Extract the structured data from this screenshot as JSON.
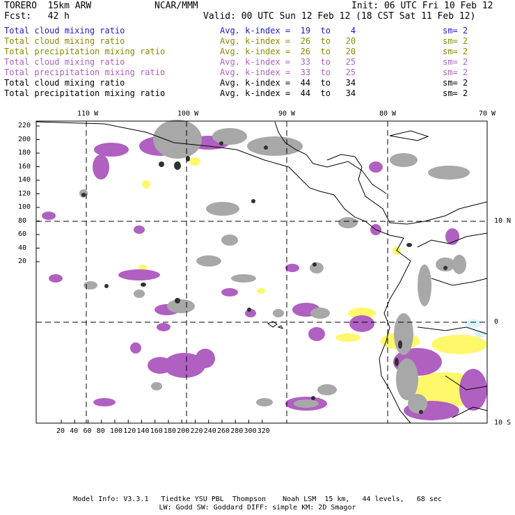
{
  "header": {
    "model": "TORERO  15km ARW",
    "org": "NCAR/MMM",
    "init": "Init: 06 UTC Fri 10 Feb 12",
    "fcst": "Fcst:   42 h",
    "valid": "Valid: 00 UTC Sun 12 Feb 12 (18 CST Sat 11 Feb 12)"
  },
  "legend": [
    {
      "field": "Total cloud mixing ratio",
      "kindex": "Avg. k-index =  19  to    4",
      "sm": "sm= 2",
      "color": "#1a1acc"
    },
    {
      "field": "Total cloud mixing ratio",
      "kindex": "Avg. k-index =  26  to   20",
      "sm": "sm= 2",
      "color": "#8a8a00"
    },
    {
      "field": "Total precipitation mixing ratio",
      "kindex": "Avg. k-index =  26  to   20",
      "sm": "sm= 2",
      "color": "#8a8a00"
    },
    {
      "field": "Total cloud mixing ratio",
      "kindex": "Avg. k-index =  33  to   25",
      "sm": "sm= 2",
      "color": "#b060c0"
    },
    {
      "field": "Total precipitation mixing ratio",
      "kindex": "Avg. k-index =  33  to   25",
      "sm": "sm= 2",
      "color": "#b060c0"
    },
    {
      "field": "Total cloud mixing ratio",
      "kindex": "Avg. k-index =  44  to   34",
      "sm": "sm= 2",
      "color": "#000000"
    },
    {
      "field": "Total precipitation mixing ratio",
      "kindex": "Avg. k-index =  44  to   34",
      "sm": "sm= 2",
      "color": "#000000"
    }
  ],
  "map": {
    "lon_labels": [
      "110 W",
      "100 W",
      "90 W",
      "80 W",
      "70 W"
    ],
    "lat_labels": [
      "10 N",
      "0",
      "10 S"
    ],
    "y_grid_labels": [
      "220",
      "200",
      "180",
      "160",
      "140",
      "120",
      "100",
      "80",
      "60",
      "40",
      "20"
    ],
    "x_grid_labels": [
      "20",
      "40",
      "60",
      "80",
      "100",
      "120",
      "140",
      "160",
      "180",
      "200",
      "220",
      "240",
      "260",
      "280",
      "300",
      "320"
    ],
    "colors": {
      "gray": "#a8a8a8",
      "purple": "#b060c0",
      "yellow": "#fff86a",
      "cyan": "#d8f4fa",
      "dark": "#303030",
      "coast": "#000000"
    }
  },
  "footer": {
    "line1": "Model Info: V3.3.1   Tiedtke YSU PBL  Thompson    Noah LSM  15 km,   44 levels,   68 sec",
    "line2": "LW: Godd SW: Goddard DIFF: simple KM: 2D Smagor"
  }
}
